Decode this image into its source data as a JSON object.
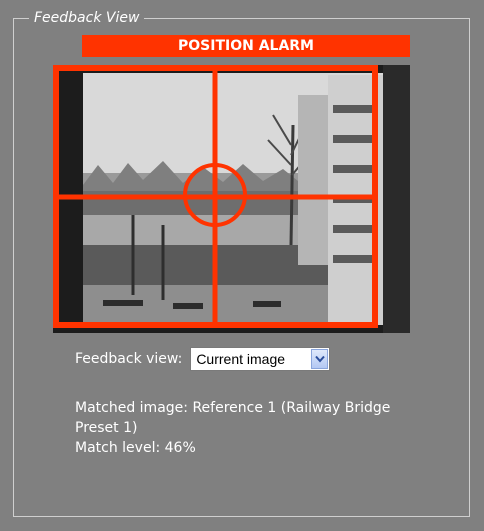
{
  "panel": {
    "legend": "Feedback View"
  },
  "alarm": {
    "label": "POSITION ALARM",
    "color": "#ff3300"
  },
  "camera": {
    "crosshair_color": "#ff3300"
  },
  "feedback": {
    "label": "Feedback view:",
    "select_value": "Current image",
    "select_icon": "chevron-down-icon"
  },
  "match": {
    "matched_image_line1": "Matched image: Reference 1 (Railway Bridge",
    "matched_image_line2": "Preset 1)",
    "match_level": "Match level: 46%"
  }
}
